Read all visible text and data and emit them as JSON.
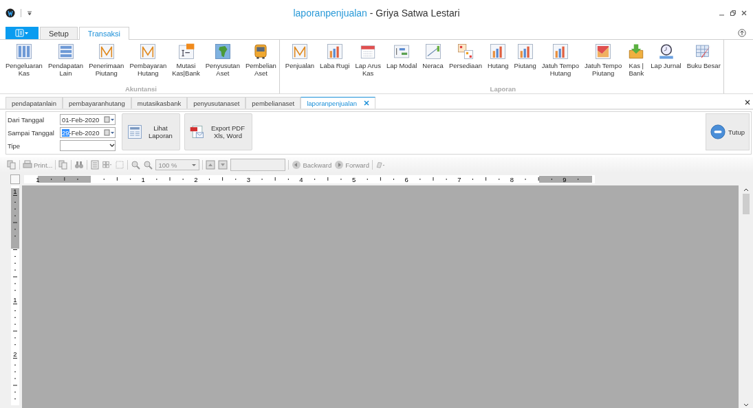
{
  "window": {
    "title_document": "laporanpenjualan",
    "title_app": "- Griya Satwa Lestari"
  },
  "ribbon_tabs": [
    {
      "label": "Setup",
      "selected": false
    },
    {
      "label": "Transaksi",
      "selected": true
    }
  ],
  "ribbon_groups": [
    {
      "label": "Akuntansi",
      "buttons": [
        {
          "label": "Pengeluaran\nKas"
        },
        {
          "label": "Pendapatan\nLain"
        },
        {
          "label": "Penerimaan\nPiutang"
        },
        {
          "label": "Pembayaran\nHutang"
        },
        {
          "label": "Mutasi\nKas|Bank"
        },
        {
          "label": "Penyusutan\nAset"
        },
        {
          "label": "Pembelian\nAset"
        }
      ]
    },
    {
      "label": "Laporan",
      "buttons": [
        {
          "label": "Penjualan"
        },
        {
          "label": "Laba Rugi"
        },
        {
          "label": "Lap Arus\nKas"
        },
        {
          "label": "Lap Modal"
        },
        {
          "label": "Neraca"
        },
        {
          "label": "Persediaan"
        },
        {
          "label": "Hutang"
        },
        {
          "label": "Piutang"
        },
        {
          "label": "Jatuh Tempo\nHutang"
        },
        {
          "label": "Jatuh Tempo\nPiutang"
        },
        {
          "label": "Kas |\nBank"
        },
        {
          "label": "Lap Jurnal"
        },
        {
          "label": "Buku Besar"
        }
      ]
    }
  ],
  "doc_tabs": [
    {
      "label": "pendapatanlain",
      "selected": false
    },
    {
      "label": "pembayaranhutang",
      "selected": false
    },
    {
      "label": "mutasikasbank",
      "selected": false
    },
    {
      "label": "penyusutanaset",
      "selected": false
    },
    {
      "label": "pembelianaset",
      "selected": false
    },
    {
      "label": "laporanpenjualan",
      "selected": true
    }
  ],
  "form": {
    "fields": [
      {
        "label": "Dari Tanggal",
        "kind": "date",
        "text": "01-Feb-2020"
      },
      {
        "label": "Sampai Tanggal",
        "kind": "date",
        "selected_text": "29",
        "text": "-Feb-2020"
      },
      {
        "label": "Tipe",
        "kind": "select"
      }
    ],
    "buttons": [
      "Lihat\nLaporan",
      "Export PDF\nXls, Word"
    ],
    "close_button": "Tutup"
  },
  "preview_toolbar": {
    "print": "Print...",
    "zoom": "100 %",
    "backward": "Backward",
    "forward": "Forward",
    "disabled": true
  },
  "ruler": {
    "horizontal": [
      "1",
      "1",
      "2",
      "3",
      "4",
      "5",
      "6",
      "7",
      "8",
      "9"
    ],
    "vertical": [
      "1",
      "1",
      "2"
    ]
  }
}
